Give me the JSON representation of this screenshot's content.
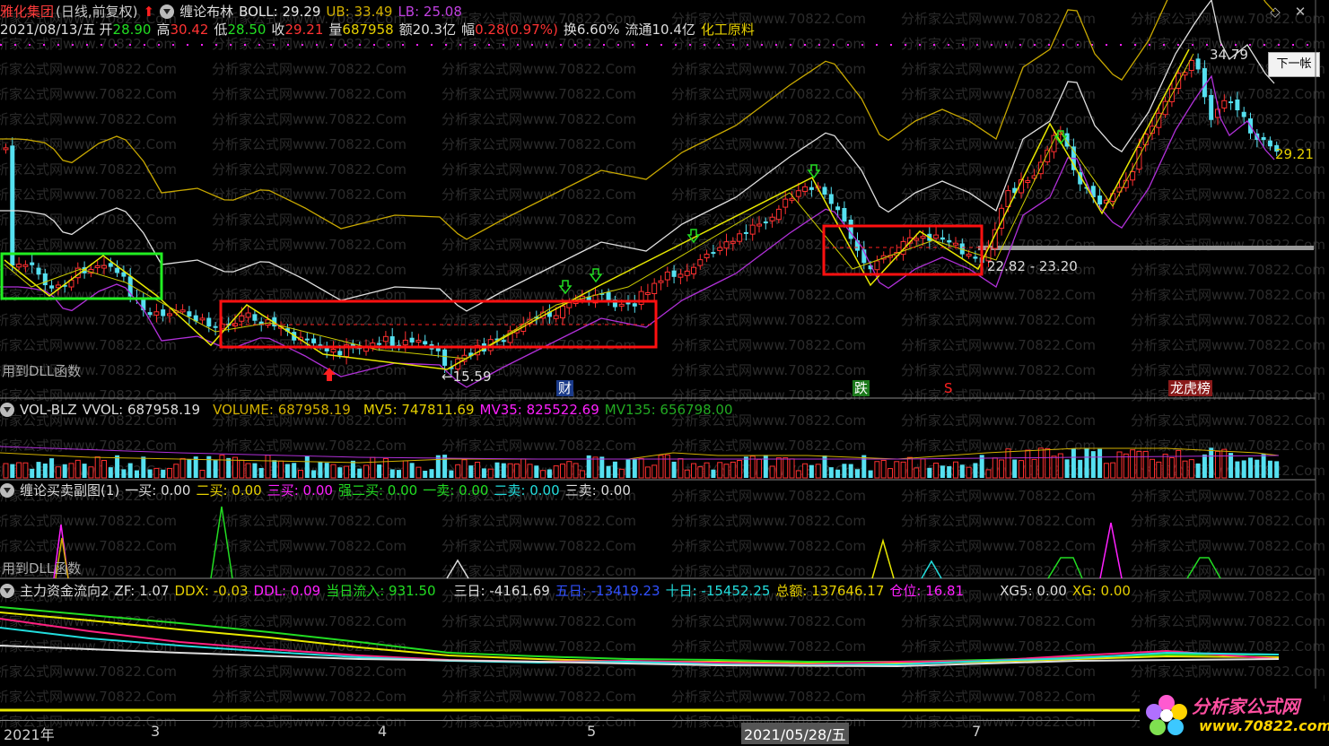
{
  "header": {
    "stock_name": "雅化集团",
    "period": "(日线,前复权)",
    "arrow": "⬆",
    "indicator": "缠论布林",
    "boll_label": "BOLL: 29.29",
    "ub_label": "UB: 33.49",
    "lb_label": "LB: 25.08",
    "date": "2021/08/13/五",
    "open_label": "开",
    "open": "28.90",
    "high_label": "高",
    "high": "30.42",
    "low_label": "低",
    "low": "28.50",
    "close_label": "收",
    "close": "29.21",
    "volume_label": "量",
    "volume": "687958",
    "amount": "额20.3亿",
    "change_label": "幅",
    "change": "0.28(0.97%)",
    "turnover": "换6.60%",
    "float_cap": "流通10.4亿",
    "sector": "化工原料"
  },
  "watermark": {
    "text_a": "分析家公式网www.70822.Com",
    "text_b": "w.70822.Com"
  },
  "main_panel": {
    "dll_note": "用到DLL函数",
    "high_price_label": "34.79",
    "low_price_label": "←15.59",
    "last_price_label": "29.21",
    "range_label": "22.82 - 23.20",
    "event_cai": "财",
    "event_die": "跌",
    "event_s": "S",
    "event_bang": "龙虎榜"
  },
  "volume_panel": {
    "name": "VOL-BLZ",
    "vvol": "VVOL: 687958.19",
    "volume": "VOLUME: 687958.19",
    "mv5": "MV5: 747811.69",
    "mv35": "MV35: 825522.69",
    "mv135": "MV135: 656798.00"
  },
  "signal_panel": {
    "name": "缠论买卖副图(1)",
    "buy1": "一买: 0.00",
    "buy2": "二买: 0.00",
    "buy3": "三买: 0.00",
    "strong_buy2": "强二买: 0.00",
    "sell1": "一卖: 0.00",
    "sell2": "二卖: 0.00",
    "sell3": "三卖: 0.00",
    "dll_note": "用到DLL函数"
  },
  "flow_panel": {
    "name": "主力资金流向2",
    "zf": "ZF: 1.07",
    "ddx": "DDX: -0.03",
    "ddl": "DDL: 0.09",
    "today_in": "当日流入: 931.50",
    "three_day": "三日: -4161.69",
    "five_day": "五日: -13419.23",
    "ten_day": "十日: -15452.25",
    "total": "总额: 137646.17",
    "position": "仓位: 16.81",
    "xg5": "XG5: 0.00",
    "xg": "XG: 0.00"
  },
  "axis": {
    "y2021": "2021年",
    "m3": "3",
    "m4": "4",
    "m5": "5",
    "cursor_date": "2021/05/28/五",
    "m7": "7"
  },
  "controls": {
    "next_button": "下一帐",
    "restore_icon": "◇",
    "close_icon": "✕"
  },
  "logo": {
    "title": "分析家公式网",
    "url": "www.70822.com"
  },
  "colors": {
    "up": "#ff3030",
    "down": "#55e0f0",
    "boll_mid": "#e0e0e0",
    "boll_up": "#c8a800",
    "boll_low": "#b030d8",
    "box_red": "#ff1010",
    "box_green": "#22ee22",
    "magenta": "#ff20ff"
  }
}
